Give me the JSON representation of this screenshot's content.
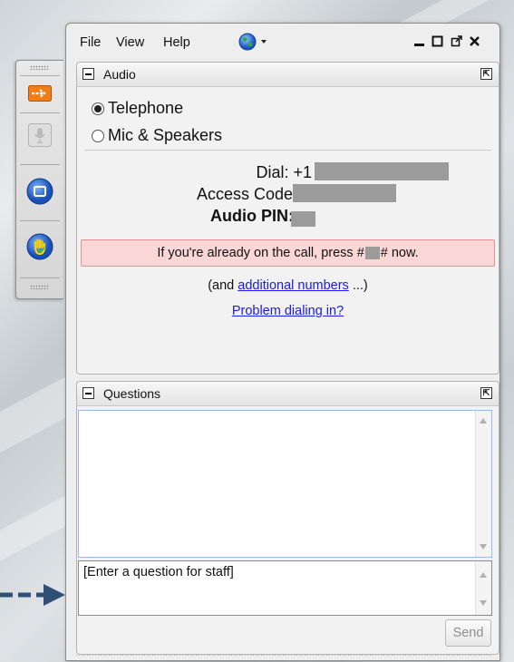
{
  "menu": {
    "file": "File",
    "view": "View",
    "help": "Help"
  },
  "window_buttons": {
    "minimize": "minimize-icon",
    "maximize": "maximize-icon",
    "popout": "popout-icon",
    "close": "close-icon"
  },
  "audio": {
    "title": "Audio",
    "options": [
      "Telephone",
      "Mic & Speakers"
    ],
    "selected": "Telephone",
    "dial_label": "Dial: +1",
    "access_code_label": "Access Code:",
    "audio_pin_label": "Audio PIN:",
    "alert_prefix": "If you're already on the call, press #",
    "alert_suffix": "# now.",
    "additional_prefix": "(and ",
    "additional_link": "additional numbers",
    "additional_suffix": " ...)",
    "problem_link": "Problem dialing in?"
  },
  "questions": {
    "title": "Questions",
    "input_placeholder": "[Enter a question for staff]",
    "send_label": "Send"
  },
  "sidebar": {
    "icons": [
      "arrow-icon",
      "microphone-icon",
      "screen-icon",
      "raise-hand-icon"
    ]
  },
  "colors": {
    "alert_bg": "#fbd6d6",
    "link": "#1a1aee",
    "annotation_arrow": "#2f4f74"
  }
}
